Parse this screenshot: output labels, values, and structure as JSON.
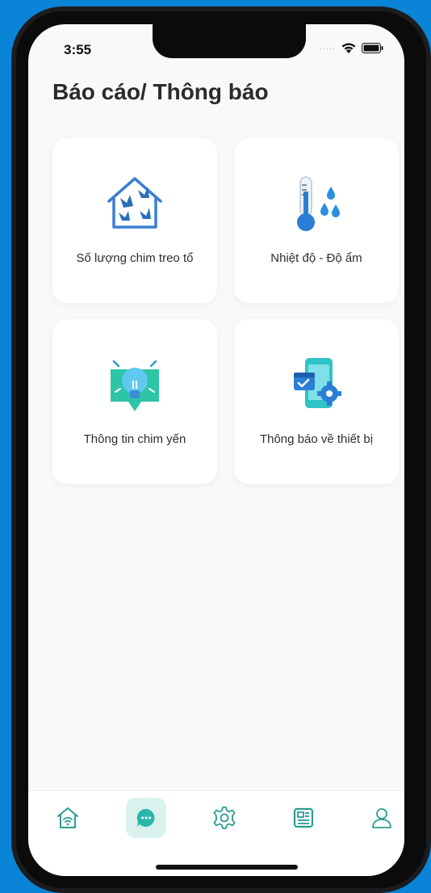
{
  "status_bar": {
    "time": "3:55",
    "signal": "·····"
  },
  "page": {
    "title": "Báo cáo/ Thông báo"
  },
  "cards": [
    {
      "label": "Số lượng chim treo tổ",
      "icon": "bird-house-icon"
    },
    {
      "label": "Nhiệt độ - Độ ẩm",
      "icon": "thermometer-humidity-icon"
    },
    {
      "label": "Thông tin chim yến",
      "icon": "lightbulb-info-icon"
    },
    {
      "label": "Thông báo về thiết bị",
      "icon": "device-settings-icon"
    }
  ],
  "tabbar": {
    "items": [
      {
        "icon": "home-wifi-icon",
        "active": false
      },
      {
        "icon": "chat-icon",
        "active": true
      },
      {
        "icon": "gear-icon",
        "active": false
      },
      {
        "icon": "news-icon",
        "active": false
      },
      {
        "icon": "user-icon",
        "active": false
      }
    ],
    "active_color": "#2ab7a9",
    "inactive_color": "#2a9d8f"
  },
  "colors": {
    "background": "#0a84d6",
    "screen": "#f9f9f9",
    "accent": "#2ab7a9"
  }
}
